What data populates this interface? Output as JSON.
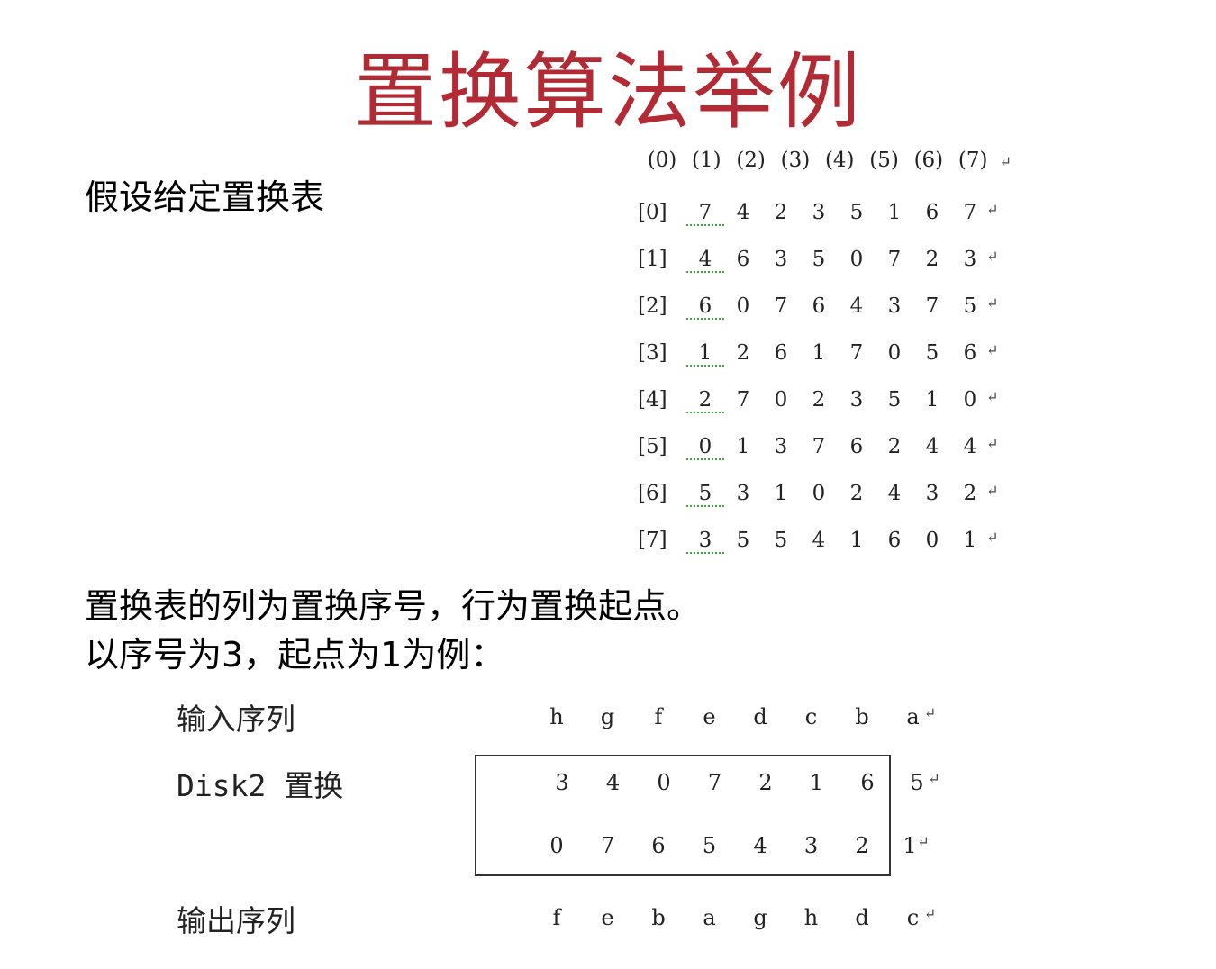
{
  "title": "置换算法举例",
  "intro": "假设给定置换表",
  "table": {
    "column_headers": [
      "(0)",
      "(1)",
      "(2)",
      "(3)",
      "(4)",
      "(5)",
      "(6)",
      "(7)"
    ],
    "rows": [
      {
        "label": "[0]",
        "values": [
          "7",
          "4",
          "2",
          "3",
          "5",
          "1",
          "6",
          "7"
        ]
      },
      {
        "label": "[1]",
        "values": [
          "4",
          "6",
          "3",
          "5",
          "0",
          "7",
          "2",
          "3"
        ]
      },
      {
        "label": "[2]",
        "values": [
          "6",
          "0",
          "7",
          "6",
          "4",
          "3",
          "7",
          "5"
        ]
      },
      {
        "label": "[3]",
        "values": [
          "1",
          "2",
          "6",
          "1",
          "7",
          "0",
          "5",
          "6"
        ]
      },
      {
        "label": "[4]",
        "values": [
          "2",
          "7",
          "0",
          "2",
          "3",
          "5",
          "1",
          "0"
        ]
      },
      {
        "label": "[5]",
        "values": [
          "0",
          "1",
          "3",
          "7",
          "6",
          "2",
          "4",
          "4"
        ]
      },
      {
        "label": "[6]",
        "values": [
          "5",
          "3",
          "1",
          "0",
          "2",
          "4",
          "3",
          "2"
        ]
      },
      {
        "label": "[7]",
        "values": [
          "3",
          "5",
          "5",
          "4",
          "1",
          "6",
          "0",
          "1"
        ]
      }
    ]
  },
  "description": {
    "line1": "置换表的列为置换序号，行为置换起点。",
    "line2": "以序号为3，起点为1为例："
  },
  "example": {
    "input_label": "输入序列",
    "input_sequence": [
      "h",
      "g",
      "f",
      "e",
      "d",
      "c",
      "b",
      "a"
    ],
    "disk_label": "Disk2 置换",
    "disk_row1": [
      "",
      "3",
      "4",
      "0",
      "7",
      "2",
      "1",
      "6",
      "5"
    ],
    "disk_row2": [
      "0",
      "7",
      "6",
      "5",
      "4",
      "3",
      "2",
      "1"
    ],
    "output_label": "输出序列",
    "output_sequence": [
      "f",
      "e",
      "b",
      "a",
      "g",
      "h",
      "d",
      "c"
    ]
  }
}
